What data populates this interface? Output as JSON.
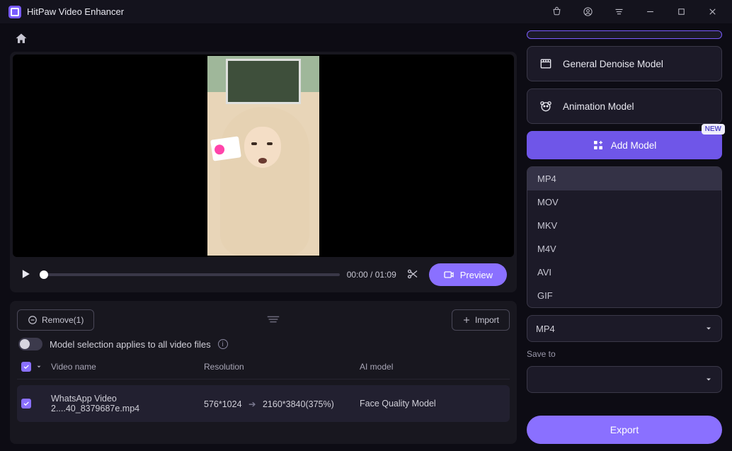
{
  "app": {
    "title": "HitPaw Video Enhancer"
  },
  "player": {
    "time": "00:00 / 01:09",
    "preview_label": "Preview"
  },
  "list": {
    "remove_label": "Remove(1)",
    "import_label": "Import",
    "toggle_label": "Model selection applies to all video files",
    "headers": {
      "name": "Video name",
      "resolution": "Resolution",
      "model": "AI model"
    },
    "rows": [
      {
        "name": "WhatsApp Video 2....40_8379687e.mp4",
        "res_in": "576*1024",
        "res_out": "2160*3840(375%)",
        "model": "Face Quality Model"
      }
    ]
  },
  "models": {
    "denoise": "General Denoise Model",
    "animation": "Animation Model",
    "add_label": "Add Model",
    "new_badge": "NEW"
  },
  "formats": {
    "options": [
      "MP4",
      "MOV",
      "MKV",
      "M4V",
      "AVI",
      "GIF"
    ],
    "selected": "MP4"
  },
  "output": {
    "format_select": "MP4",
    "save_to_label": "Save to",
    "save_to_value": ""
  },
  "export_label": "Export"
}
